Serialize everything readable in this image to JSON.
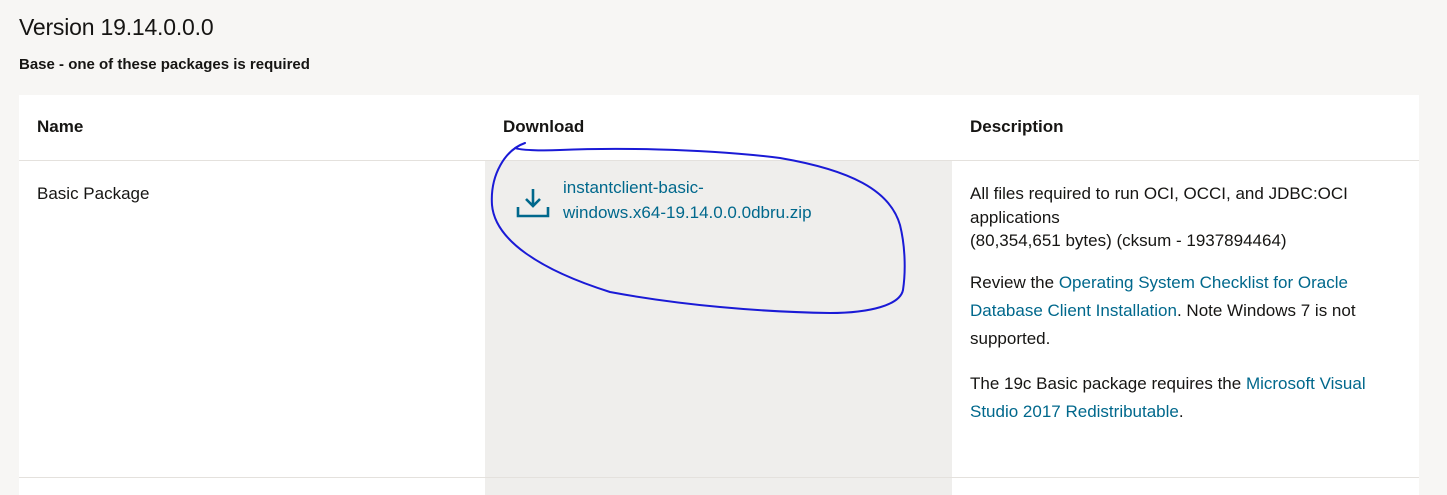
{
  "version_title": "Version 19.14.0.0.0",
  "subtitle": "Base - one of these packages is required",
  "table": {
    "headers": {
      "name": "Name",
      "download": "Download",
      "description": "Description"
    },
    "row": {
      "name": "Basic Package",
      "download": {
        "line1": "instantclient-basic-",
        "line2": "windows.x64-19.14.0.0.0dbru.zip",
        "icon": "download-icon"
      },
      "description": {
        "p1_line1": "All files required to run OCI, OCCI, and JDBC:OCI",
        "p1_line2": "applications",
        "p1_line3": "(80,354,651 bytes) (cksum - 1937894464)",
        "p2_pre": "Review the ",
        "p2_link_line1": "Operating System Checklist for Oracle",
        "p2_link_line2": "Database Client Installation",
        "p2_post_line1": ". Note Windows 7 is not",
        "p2_post_line2": "supported.",
        "p3_pre": "The 19c Basic package requires the ",
        "p3_link_line1": "Microsoft Visual",
        "p3_link_line2": "Studio 2017 Redistributable",
        "p3_post": "."
      }
    }
  },
  "colors": {
    "link": "#00688c",
    "annotation": "#1a1ad6",
    "page_bg": "#f7f6f4",
    "download_col_bg": "#efeeec"
  }
}
